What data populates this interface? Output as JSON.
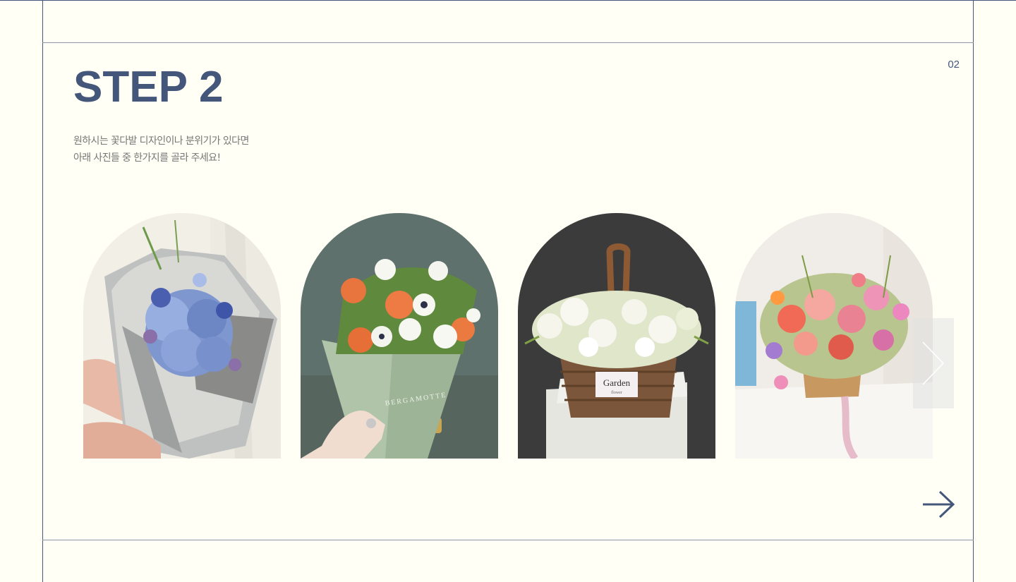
{
  "step": {
    "title": "STEP 2",
    "number": "02",
    "description_line1": "원하시는 꽃다발 디자인이나 분위기가 있다면",
    "description_line2": "아래 사진들 중 한가지를 골라 주세요!"
  },
  "gallery": {
    "items": [
      {
        "label": "blue-hydrangea-bouquet"
      },
      {
        "label": "orange-tulip-anemone-bouquet"
      },
      {
        "label": "white-freesia-basket"
      },
      {
        "label": "pink-coral-flower-basket"
      }
    ],
    "basket_tag_title": "Garden",
    "basket_tag_sub": "flower"
  },
  "wrap_text": "BERGAMOTTE",
  "colors": {
    "accent": "#44577a",
    "background": "#fffff5",
    "text_muted": "#777777"
  },
  "icons": {
    "slider_next": "chevron-right-icon",
    "step_next": "arrow-right-icon"
  }
}
